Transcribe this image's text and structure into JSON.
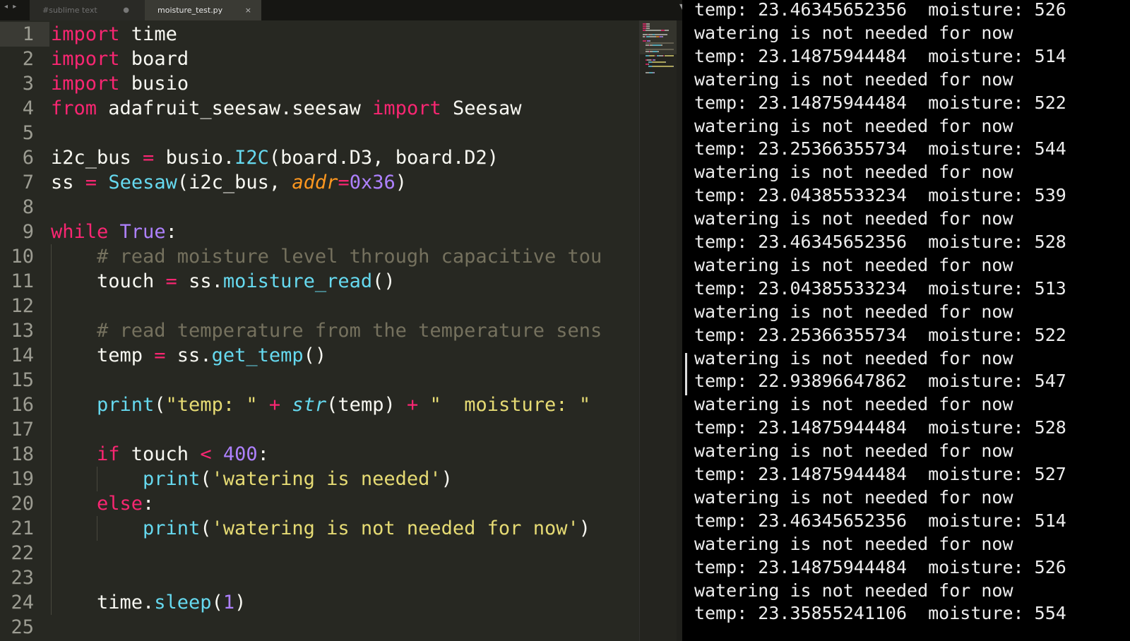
{
  "editor": {
    "tabs": [
      {
        "label": "#sublime text",
        "active": false,
        "dirty_marker": "●"
      },
      {
        "label": "moisture_test.py",
        "active": true,
        "close_marker": "×"
      }
    ],
    "tab_nav_arrows": "◂ ▸",
    "tab_menu_arrow": "▼",
    "lines": [
      {
        "n": "1",
        "indent": 0,
        "tokens": [
          [
            "kw",
            "import"
          ],
          [
            "pl",
            " time"
          ]
        ]
      },
      {
        "n": "2",
        "indent": 0,
        "tokens": [
          [
            "kw",
            "import"
          ],
          [
            "pl",
            " board"
          ]
        ]
      },
      {
        "n": "3",
        "indent": 0,
        "tokens": [
          [
            "kw",
            "import"
          ],
          [
            "pl",
            " busio"
          ]
        ]
      },
      {
        "n": "4",
        "indent": 0,
        "tokens": [
          [
            "kw",
            "from"
          ],
          [
            "pl",
            " adafruit_seesaw.seesaw "
          ],
          [
            "kw",
            "import"
          ],
          [
            "pl",
            " Seesaw"
          ]
        ]
      },
      {
        "n": "5",
        "indent": 0,
        "tokens": []
      },
      {
        "n": "6",
        "indent": 0,
        "tokens": [
          [
            "pl",
            "i2c_bus "
          ],
          [
            "kw",
            "="
          ],
          [
            "pl",
            " busio."
          ],
          [
            "fn",
            "I2C"
          ],
          [
            "pl",
            "(board.D3, board.D2)"
          ]
        ]
      },
      {
        "n": "7",
        "indent": 0,
        "tokens": [
          [
            "pl",
            "ss "
          ],
          [
            "kw",
            "="
          ],
          [
            "pl",
            " "
          ],
          [
            "fn",
            "Seesaw"
          ],
          [
            "pl",
            "(i2c_bus, "
          ],
          [
            "pa",
            "addr"
          ],
          [
            "kw",
            "="
          ],
          [
            "nu",
            "0x36"
          ],
          [
            "pl",
            ")"
          ]
        ]
      },
      {
        "n": "8",
        "indent": 0,
        "tokens": []
      },
      {
        "n": "9",
        "indent": 0,
        "tokens": [
          [
            "kw",
            "while"
          ],
          [
            "pl",
            " "
          ],
          [
            "nu",
            "True"
          ],
          [
            "pl",
            ":"
          ]
        ]
      },
      {
        "n": "10",
        "indent": 1,
        "tokens": [
          [
            "cm",
            "# read moisture level through capacitive tou"
          ]
        ]
      },
      {
        "n": "11",
        "indent": 1,
        "tokens": [
          [
            "pl",
            "touch "
          ],
          [
            "kw",
            "="
          ],
          [
            "pl",
            " ss."
          ],
          [
            "fn",
            "moisture_read"
          ],
          [
            "pl",
            "()"
          ]
        ]
      },
      {
        "n": "12",
        "indent": 1,
        "tokens": []
      },
      {
        "n": "13",
        "indent": 1,
        "tokens": [
          [
            "cm",
            "# read temperature from the temperature sens"
          ]
        ]
      },
      {
        "n": "14",
        "indent": 1,
        "tokens": [
          [
            "pl",
            "temp "
          ],
          [
            "kw",
            "="
          ],
          [
            "pl",
            " ss."
          ],
          [
            "fn",
            "get_temp"
          ],
          [
            "pl",
            "()"
          ]
        ]
      },
      {
        "n": "15",
        "indent": 1,
        "tokens": []
      },
      {
        "n": "16",
        "indent": 1,
        "tokens": [
          [
            "fn",
            "print"
          ],
          [
            "pl",
            "("
          ],
          [
            "st",
            "\"temp: \""
          ],
          [
            "pl",
            " "
          ],
          [
            "kw",
            "+"
          ],
          [
            "pl",
            " "
          ],
          [
            "it",
            "str"
          ],
          [
            "pl",
            "(temp) "
          ],
          [
            "kw",
            "+"
          ],
          [
            "pl",
            " "
          ],
          [
            "st",
            "\"  moisture: \""
          ]
        ]
      },
      {
        "n": "17",
        "indent": 1,
        "tokens": []
      },
      {
        "n": "18",
        "indent": 1,
        "tokens": [
          [
            "kw",
            "if"
          ],
          [
            "pl",
            " touch "
          ],
          [
            "kw",
            "<"
          ],
          [
            "pl",
            " "
          ],
          [
            "nu",
            "400"
          ],
          [
            "pl",
            ":"
          ]
        ]
      },
      {
        "n": "19",
        "indent": 2,
        "tokens": [
          [
            "fn",
            "print"
          ],
          [
            "pl",
            "("
          ],
          [
            "st",
            "'watering is needed'"
          ],
          [
            "pl",
            ")"
          ]
        ]
      },
      {
        "n": "20",
        "indent": 1,
        "tokens": [
          [
            "kw",
            "else"
          ],
          [
            "pl",
            ":"
          ]
        ]
      },
      {
        "n": "21",
        "indent": 2,
        "tokens": [
          [
            "fn",
            "print"
          ],
          [
            "pl",
            "("
          ],
          [
            "st",
            "'watering is not needed for now'"
          ],
          [
            "pl",
            ")"
          ]
        ]
      },
      {
        "n": "22",
        "indent": 1,
        "tokens": []
      },
      {
        "n": "23",
        "indent": 1,
        "tokens": []
      },
      {
        "n": "24",
        "indent": 1,
        "tokens": [
          [
            "pl",
            "time."
          ],
          [
            "fn",
            "sleep"
          ],
          [
            "pl",
            "("
          ],
          [
            "nu",
            "1"
          ],
          [
            "pl",
            ")"
          ]
        ]
      },
      {
        "n": "25",
        "indent": 0,
        "tokens": []
      }
    ],
    "colors": {
      "background": "#272822",
      "keyword": "#f92672",
      "function": "#66d9ef",
      "comment": "#75715e",
      "string": "#e6db74",
      "number": "#ae81ff",
      "parameter": "#fd971f",
      "plain": "#f8f8f2"
    }
  },
  "terminal": {
    "lines": [
      "temp: 23.46345652356  moisture: 526",
      "watering is not needed for now",
      "temp: 23.14875944484  moisture: 514",
      "watering is not needed for now",
      "temp: 23.14875944484  moisture: 522",
      "watering is not needed for now",
      "temp: 23.25366355734  moisture: 544",
      "watering is not needed for now",
      "temp: 23.04385533234  moisture: 539",
      "watering is not needed for now",
      "temp: 23.46345652356  moisture: 528",
      "watering is not needed for now",
      "temp: 23.04385533234  moisture: 513",
      "watering is not needed for now",
      "temp: 23.25366355734  moisture: 522",
      "watering is not needed for now",
      "temp: 22.93896647862  moisture: 547",
      "watering is not needed for now",
      "temp: 23.14875944484  moisture: 528",
      "watering is not needed for now",
      "temp: 23.14875944484  moisture: 527",
      "watering is not needed for now",
      "temp: 23.46345652356  moisture: 514",
      "watering is not needed for now",
      "temp: 23.14875944484  moisture: 526",
      "watering is not needed for now",
      "temp: 23.35855241106  moisture: 554"
    ],
    "colors": {
      "background": "#000000",
      "text": "#ededed"
    }
  }
}
